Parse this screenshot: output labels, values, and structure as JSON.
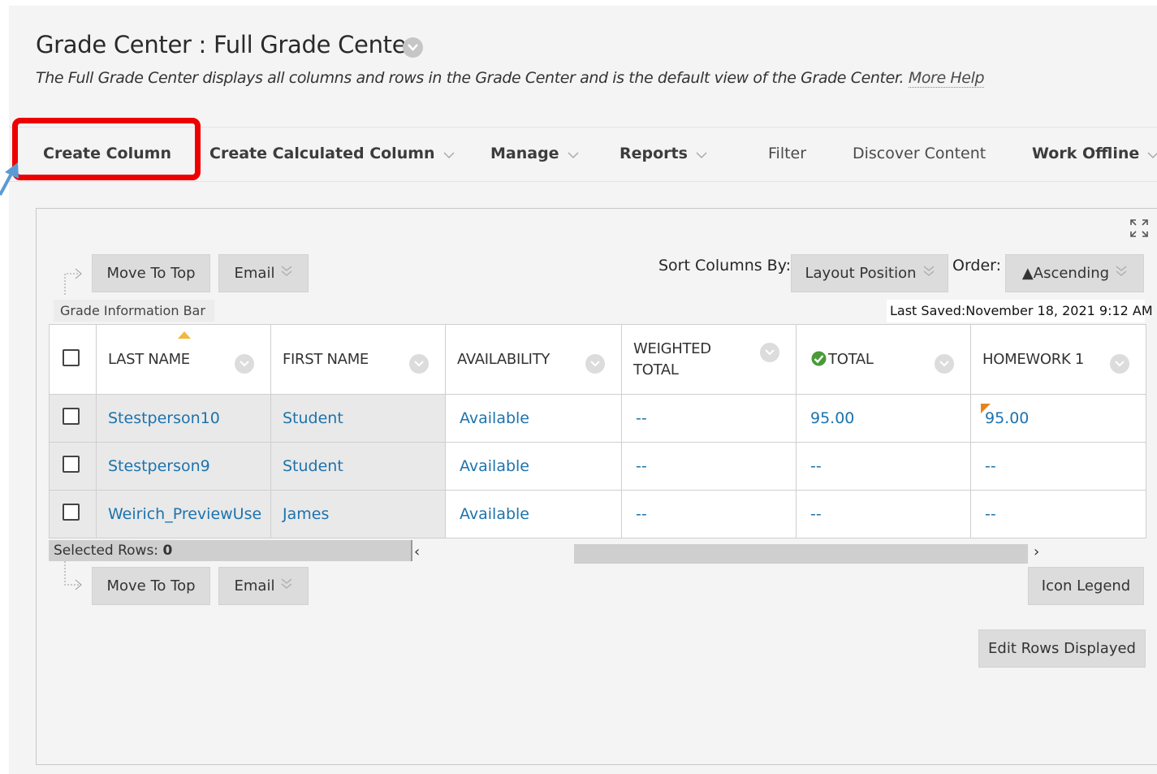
{
  "header": {
    "title": "Grade Center : Full Grade Center",
    "description": "The Full Grade Center displays all columns and rows in the Grade Center and is the default view of the Grade Center.",
    "more_help": "More Help"
  },
  "action_bar": {
    "create_column": "Create Column",
    "create_calculated_column": "Create Calculated Column",
    "manage": "Manage",
    "reports": "Reports",
    "filter": "Filter",
    "discover_content": "Discover Content",
    "work_offline": "Work Offline"
  },
  "toolbar": {
    "move_to_top": "Move To Top",
    "email": "Email",
    "sort_columns_by_label": "Sort Columns By:",
    "sort_columns_by_value": "Layout Position",
    "order_label": "Order:",
    "order_value": "▲Ascending"
  },
  "info_bar": {
    "label": "Grade Information Bar",
    "last_saved": "Last Saved:November 18, 2021 9:12 AM"
  },
  "grid": {
    "headers": [
      "LAST NAME",
      "FIRST NAME",
      "AVAILABILITY",
      "WEIGHTED TOTAL",
      "TOTAL",
      "HOMEWORK 1"
    ],
    "rows": [
      {
        "last": "Stestperson10",
        "first": "Student",
        "availability": "Available",
        "weighted": "--",
        "total": "95.00",
        "hw1": "95.00"
      },
      {
        "last": "Stestperson9",
        "first": "Student",
        "availability": "Available",
        "weighted": "--",
        "total": "--",
        "hw1": "--"
      },
      {
        "last": "Weirich_PreviewUse",
        "first": "James",
        "availability": "Available",
        "weighted": "--",
        "total": "--",
        "hw1": "--"
      }
    ]
  },
  "footer": {
    "selected_rows_label": "Selected Rows:",
    "selected_rows_count": "0",
    "icon_legend": "Icon Legend",
    "edit_rows_displayed": "Edit Rows Displayed"
  },
  "colors": {
    "highlight": "#ee0000",
    "link": "#1d73ad",
    "annotation_arrow": "#5b9bd5"
  }
}
